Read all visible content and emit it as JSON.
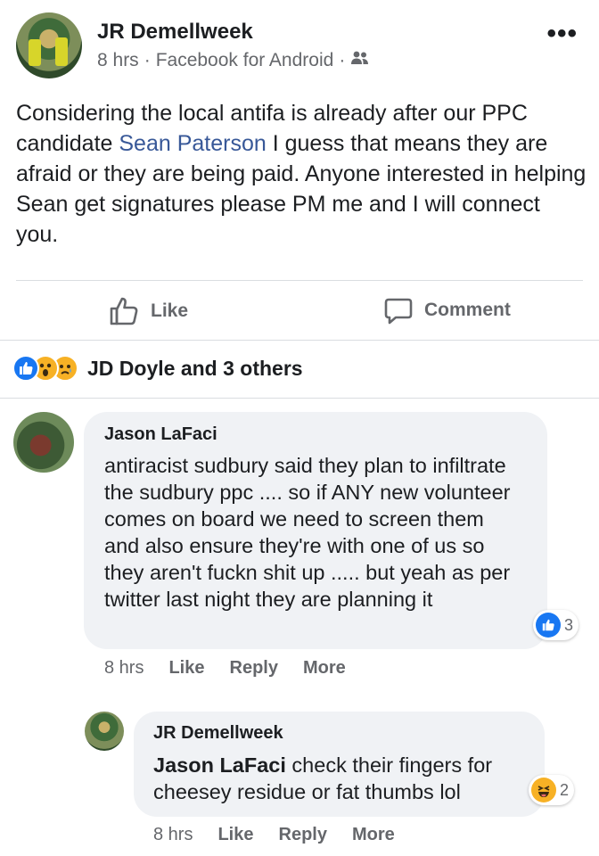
{
  "post": {
    "author": "JR Demellweek",
    "time": "8 hrs",
    "source": "Facebook for Android",
    "separator": "·",
    "more": "•••",
    "text_before": "Considering the local antifa is already after our PPC candidate ",
    "mention": "Sean Paterson",
    "text_after": " I guess that means they are afraid or they are being paid. Anyone interested in helping Sean get signatures please PM me and I will connect you."
  },
  "actions": {
    "like_label": "Like",
    "comment_label": "Comment"
  },
  "reactions_summary": {
    "text": "JD Doyle and 3 others",
    "icons": [
      "like-icon",
      "wow-icon",
      "sad-icon"
    ]
  },
  "comments": [
    {
      "author": "Jason LaFaci",
      "text": "antiracist sudbury said they plan to infiltrate the sudbury ppc .... so if ANY new volunteer comes on board we need to screen them and also ensure they're with one of us so they aren't fuckn shit up ..... but yeah as per twitter last night they are planning it",
      "reaction_count": "3",
      "reaction_icon": "like-icon",
      "time": "8 hrs",
      "like": "Like",
      "reply": "Reply",
      "more": "More"
    },
    {
      "author": "JR Demellweek",
      "mention": "Jason LaFaci",
      "text": " check their fingers for cheesey residue or fat thumbs lol",
      "reaction_count": "2",
      "reaction_icon": "haha-icon",
      "time": "8 hrs",
      "like": "Like",
      "reply": "Reply",
      "more": "More"
    }
  ],
  "colors": {
    "link": "#385898",
    "like_blue": "#1877f2",
    "emoji_yellow": "#f7b125",
    "secondary_text": "#65676b",
    "bubble_bg": "#f0f2f5"
  }
}
